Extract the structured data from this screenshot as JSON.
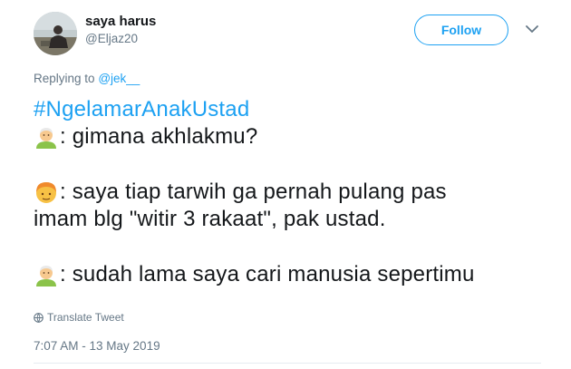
{
  "author": {
    "name": "saya harus",
    "handle": "@Eljaz20"
  },
  "actions": {
    "follow_label": "Follow"
  },
  "reply": {
    "prefix": "Replying to",
    "mention": "@jek__"
  },
  "tweet": {
    "hashtag": "#NgelamarAnakUstad",
    "line1": ": gimana akhlakmu?",
    "line2": ": saya tiap tarwih ga pernah pulang pas",
    "line3": "imam blg \"witir 3 rakaat\", pak ustad.",
    "line4": ": sudah lama saya cari manusia sepertimu",
    "emoji_old_man": "older-man-emoji",
    "emoji_boy": "boy-emoji"
  },
  "translate_label": "Translate Tweet",
  "timestamp": "7:07 AM - 13 May 2019",
  "colors": {
    "accent": "#1da1f2",
    "muted": "#657786",
    "text": "#14171a"
  }
}
